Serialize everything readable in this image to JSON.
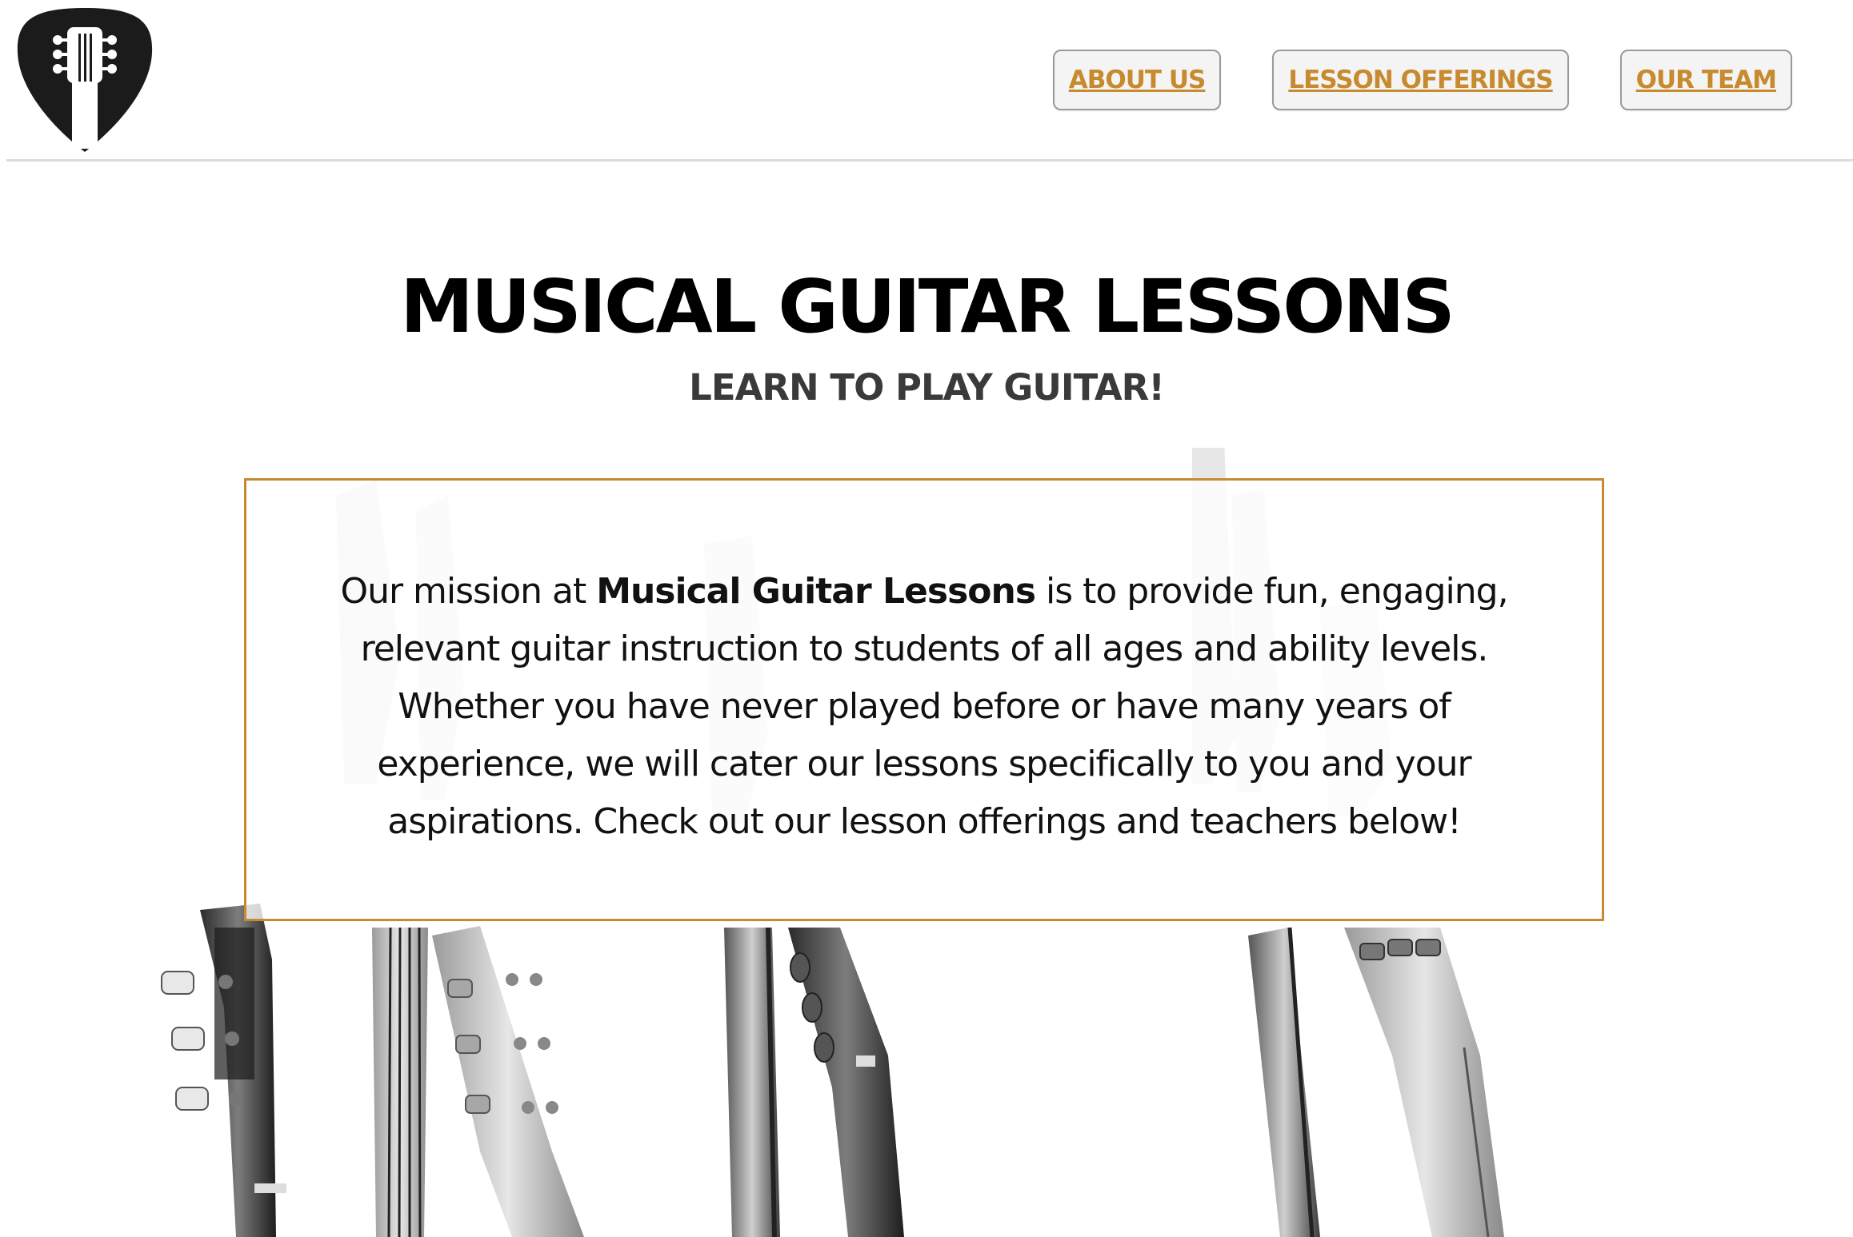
{
  "header": {
    "logo_icon": "guitar-pick-headstock-icon",
    "nav": [
      {
        "label": "ABOUT US"
      },
      {
        "label": "LESSON OFFERINGS"
      },
      {
        "label": "OUR TEAM"
      }
    ]
  },
  "hero": {
    "title": "MUSICAL GUITAR LESSONS",
    "subtitle": "LEARN TO PLAY GUITAR!"
  },
  "mission": {
    "intro": "Our mission at ",
    "brand": "Musical Guitar Lessons",
    "body": " is to provide fun, engaging, relevant guitar instruction to students of all ages and ability levels. Whether you have never played before or have many years of experience, we will cater our lessons specifically to you and your aspirations. Check out our lesson offerings and teachers below!"
  },
  "colors": {
    "accent": "#c78a2e",
    "nav_bg": "#f4f4f4",
    "title": "#000000",
    "subtitle": "#3a3a3a"
  }
}
